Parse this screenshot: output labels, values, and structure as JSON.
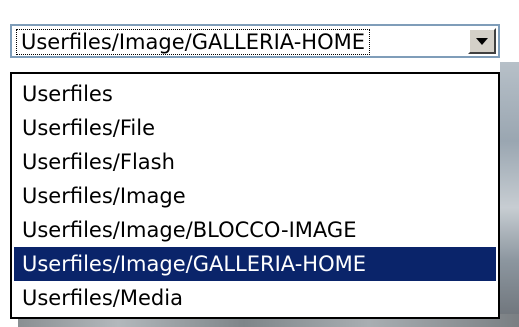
{
  "select": {
    "value": "Userfiles/Image/GALLERIA-HOME",
    "arrow_icon": "chevron-down-icon"
  },
  "options": [
    "Userfiles",
    "Userfiles/File",
    "Userfiles/Flash",
    "Userfiles/Image",
    "Userfiles/Image/BLOCCO-IMAGE",
    "Userfiles/Image/GALLERIA-HOME",
    "Userfiles/Media"
  ],
  "selected_index": 5,
  "colors": {
    "highlight_bg": "#0a246a",
    "highlight_text": "#ffffff",
    "select_border": "#7f9db9",
    "button_face": "#d4d0c8"
  }
}
